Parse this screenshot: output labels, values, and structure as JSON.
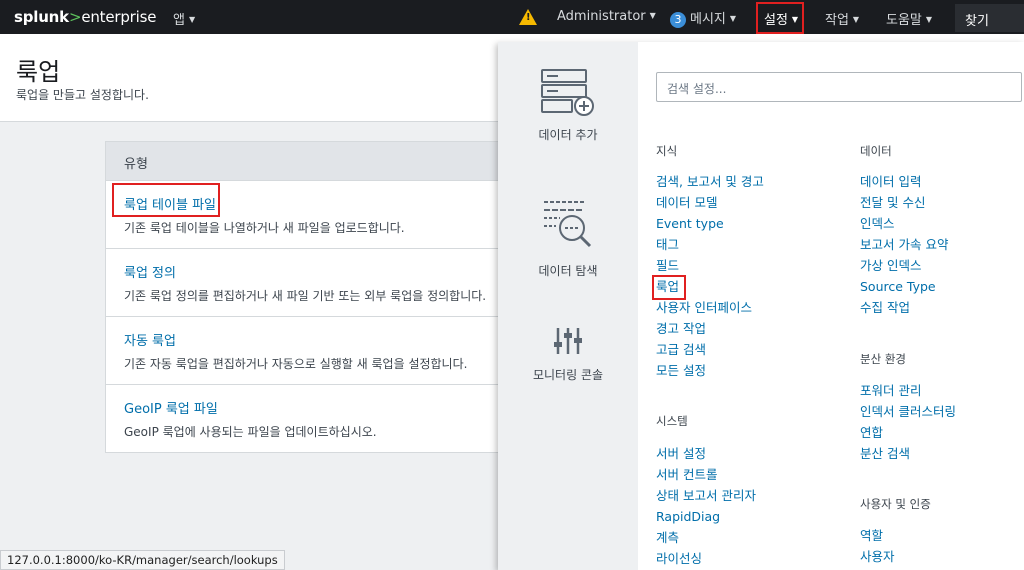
{
  "topbar": {
    "logo_brand": "splunk",
    "logo_gt": ">",
    "logo_product": "enterprise",
    "app_label": "앱",
    "user_label": "Administrator",
    "messages_count": "3",
    "messages_label": "메시지",
    "settings_label": "설정",
    "activity_label": "작업",
    "help_label": "도움말",
    "find_label": "찾기"
  },
  "page": {
    "title": "룩업",
    "subtitle": "룩업을 만들고 설정합니다."
  },
  "table": {
    "header": "유형",
    "rows": [
      {
        "link": "룩업 테이블 파일",
        "desc": "기존 룩업 테이블을 나열하거나 새 파일을 업로드합니다."
      },
      {
        "link": "룩업 정의",
        "desc": "기존 룩업 정의를 편집하거나 새 파일 기반 또는 외부 룩업을 정의합니다."
      },
      {
        "link": "자동 룩업",
        "desc": "기존 자동 룩업을 편집하거나 자동으로 실행할 새 룩업을 설정합니다."
      },
      {
        "link": "GeoIP 룩업 파일",
        "desc": "GeoIP 룩업에 사용되는 파일을 업데이트하십시오."
      }
    ]
  },
  "status_url": "127.0.0.1:8000/ko-KR/manager/search/lookups",
  "dropdown": {
    "search_placeholder": "검색 설정...",
    "tiles": {
      "add_data": "데이터 추가",
      "explore_data": "데이터 탐색",
      "monitoring_console": "모니터링 콘솔"
    },
    "knowledge": {
      "title": "지식",
      "items": [
        "검색, 보고서 및 경고",
        "데이터 모델",
        "Event type",
        "태그",
        "필드",
        "룩업",
        "사용자 인터페이스",
        "경고 작업",
        "고급 검색",
        "모든 설정"
      ]
    },
    "system": {
      "title": "시스템",
      "items": [
        "서버 설정",
        "서버 컨트롤",
        "상태 보고서 관리자",
        "RapidDiag",
        "계측",
        "라이선싱"
      ]
    },
    "data": {
      "title": "데이터",
      "items": [
        "데이터 입력",
        "전달 및 수신",
        "인덱스",
        "보고서 가속 요약",
        "가상 인덱스",
        "Source Type",
        "수집 작업"
      ]
    },
    "distributed": {
      "title": "분산 환경",
      "items": [
        "포워더 관리",
        "인덱서 클러스터링",
        "연합",
        "분산 검색"
      ]
    },
    "users": {
      "title": "사용자 및 인증",
      "items": [
        "역할",
        "사용자"
      ]
    }
  },
  "colors": {
    "topbar_bg": "#1a1c20",
    "link": "#006eaa",
    "highlight": "#e02020",
    "warning": "#f6b900",
    "badge": "#3b8ed8"
  }
}
